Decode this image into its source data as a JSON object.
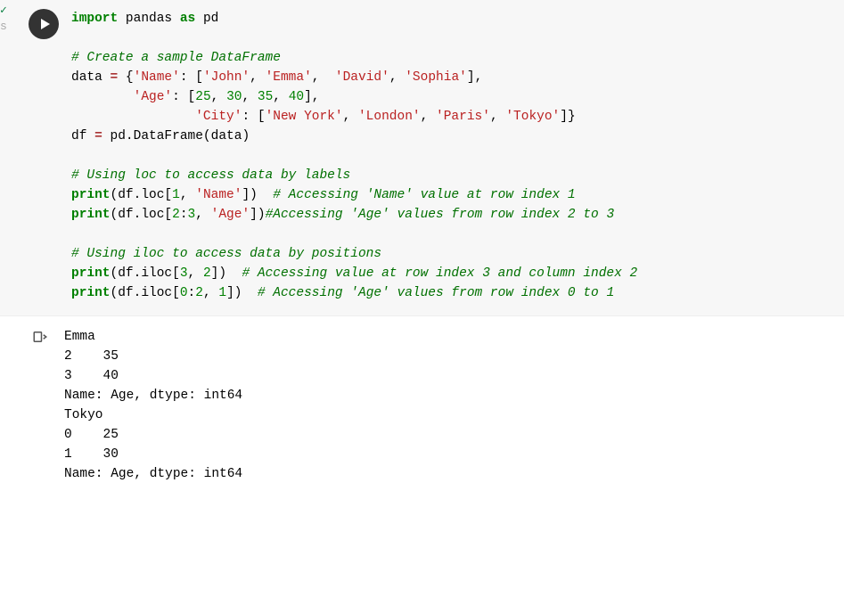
{
  "code": {
    "left_marker": "✓",
    "left_marker2": "s",
    "t": {
      "import": "import",
      "pandas": "pandas",
      "as": "as",
      "pd": "pd",
      "cmt_create": "# Create a sample DataFrame",
      "data": "data",
      "eq": "=",
      "brace_open": "{",
      "k_name": "'Name'",
      "colon": ":",
      "sq_open": "[",
      "john": "'John'",
      "comma": ",",
      "emma": "'Emma'",
      "david": "'David'",
      "sophia": "'Sophia'",
      "sq_close": "]",
      "k_age": "'Age'",
      "n25": "25",
      "n30": "30",
      "n35": "35",
      "n40": "40",
      "k_city": "'City'",
      "ny": "'New York'",
      "london": "'London'",
      "paris": "'Paris'",
      "tokyo": "'Tokyo'",
      "brace_close": "}",
      "df": "df",
      "pd_df": "pd.DataFrame(data)",
      "cmt_loc": "# Using loc to access data by labels",
      "print": "print",
      "loc1_open": "(df.loc[",
      "n1": "1",
      "loc1_close": "])",
      "cmt_loc1": "# Accessing 'Name' value at row index 1",
      "loc2_open": "(df.loc[",
      "n2": "2",
      "n3": "3",
      "loc2_close": "])",
      "cmt_loc2": "#Accessing 'Age' values from row index 2 to 3",
      "cmt_iloc": "# Using iloc to access data by positions",
      "iloc1_open": "(df.iloc[",
      "iloc1_close": "])",
      "cmt_iloc1": "# Accessing value at row index 3 and column index 2",
      "iloc2_open": "(df.iloc[",
      "n0": "0",
      "iloc2_close": "])",
      "cmt_iloc2": "# Accessing 'Age' values from row index 0 to 1"
    }
  },
  "output": {
    "line1": "Emma",
    "line2": "2    35",
    "line3": "3    40",
    "line4": "Name: Age, dtype: int64",
    "line5": "Tokyo",
    "line6": "0    25",
    "line7": "1    30",
    "line8": "Name: Age, dtype: int64"
  }
}
